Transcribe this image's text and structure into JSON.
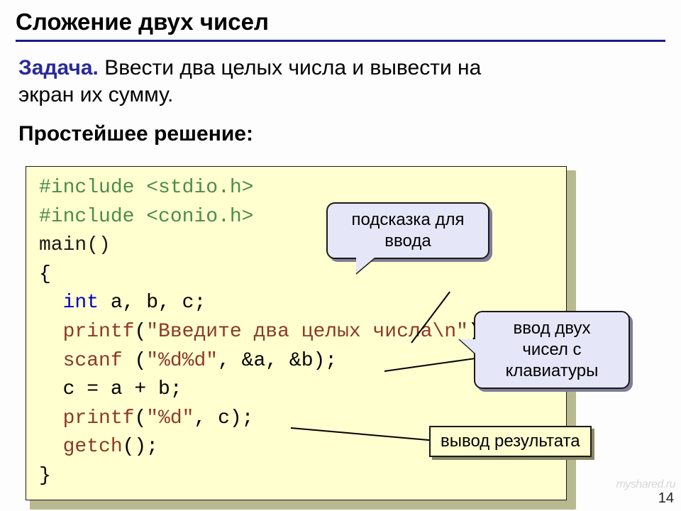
{
  "title": "Сложение двух чисел",
  "task": {
    "label": "Задача.",
    "text": " Ввести два целых числа и вывести на\n экран их сумму."
  },
  "subhead": "Простейшее решение:",
  "code": {
    "l1a": "#include ",
    "l1b": "<stdio.h>",
    "l2a": "#include ",
    "l2b": "<conio.h>",
    "l3": "main()",
    "l4": "{",
    "l5a": "  ",
    "l5b": "int",
    "l5c": " a, b, c;",
    "l6a": "  ",
    "l6b": "printf",
    "l6c": "(",
    "l6d": "\"Введите два целых числа\\n\"",
    "l6e": ");",
    "l7a": "  ",
    "l7b": "scanf ",
    "l7c": "(",
    "l7d": "\"%d%d\"",
    "l7e": ", &a, &b);",
    "l8": "  c = a + b;",
    "l9a": "  ",
    "l9b": "printf",
    "l9c": "(",
    "l9d": "\"%d\"",
    "l9e": ", c);",
    "l10a": "  ",
    "l10b": "getch",
    "l10c": "();",
    "l11": "}"
  },
  "callouts": {
    "c1": "подсказка для\nввода",
    "c2": "ввод двух\nчисел с\nклавиатуры",
    "c3": "вывод результата"
  },
  "page": "14",
  "watermark": "myshared.ru"
}
